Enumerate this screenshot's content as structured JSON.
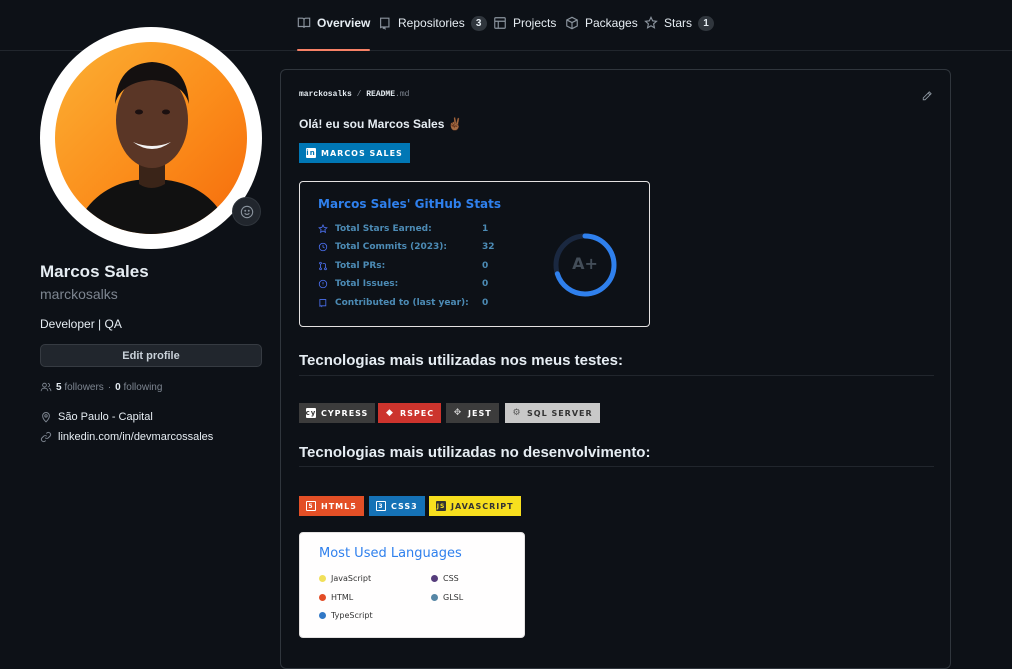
{
  "tabs": [
    {
      "label": "Overview",
      "icon": "book-icon",
      "active": true
    },
    {
      "label": "Repositories",
      "icon": "repo-icon",
      "count": "3"
    },
    {
      "label": "Projects",
      "icon": "table-icon"
    },
    {
      "label": "Packages",
      "icon": "package-icon"
    },
    {
      "label": "Stars",
      "icon": "star-icon",
      "count": "1"
    }
  ],
  "profile": {
    "name": "Marcos Sales",
    "login": "marckosalks",
    "bio": "Developer | QA",
    "edit_label": "Edit profile",
    "followers_count": "5",
    "followers_label": "followers",
    "separator": "·",
    "following_count": "0",
    "following_label": "following",
    "location": "São Paulo - Capital",
    "linkedin": "linkedin.com/in/devmarcossales"
  },
  "readme": {
    "path_user": "marckosalks",
    "path_sep": " / ",
    "path_file": "README",
    "path_ext": ".md",
    "greeting": "Olá! eu sou Marcos Sales ✌🏾",
    "linkedin_badge": {
      "label": "MARCOS SALES",
      "icon": "linkedin-icon",
      "color": "#0077b5"
    },
    "stats": {
      "title": "Marcos Sales' GitHub Stats",
      "rows": [
        {
          "label": "Total Stars Earned:",
          "value": "1",
          "icon": "star-icon"
        },
        {
          "label": "Total Commits (2023):",
          "value": "32",
          "icon": "history-icon"
        },
        {
          "label": "Total PRs:",
          "value": "0",
          "icon": "pull-request-icon"
        },
        {
          "label": "Total Issues:",
          "value": "0",
          "icon": "issue-icon"
        },
        {
          "label": "Contributed to (last year):",
          "value": "0",
          "icon": "repo-icon"
        }
      ],
      "grade": "A+",
      "grade_progress": 0.7,
      "ring_color": "#2f80ed"
    },
    "tests_heading": "Tecnologias mais utilizadas nos meus testes:",
    "tests_badges": [
      {
        "label": "CYPRESS",
        "bg": "#3c3c3c",
        "icon": "cypress-icon"
      },
      {
        "label": "RSPEC",
        "bg": "#cc342d",
        "icon": "ruby-icon"
      },
      {
        "label": "JEST",
        "bg": "#3c3c3c",
        "icon": "jest-icon"
      },
      {
        "label": "SQL SERVER",
        "bg": "#c8c8c8",
        "icon": "sql-server-icon"
      }
    ],
    "dev_heading": "Tecnologias mais utilizadas no desenvolvimento:",
    "dev_badges": [
      {
        "label": "HTML5",
        "bg": "#e34f26",
        "icon": "html5-icon"
      },
      {
        "label": "CSS3",
        "bg": "#1572b6",
        "icon": "css3-icon"
      },
      {
        "label": "JAVASCRIPT",
        "bg": "#f7df1e",
        "icon": "javascript-icon"
      }
    ],
    "languages": {
      "title": "Most Used Languages",
      "items": [
        {
          "label": "JavaScript",
          "color": "#f1e05a"
        },
        {
          "label": "CSS",
          "color": "#563d7c"
        },
        {
          "label": "HTML",
          "color": "#e34c26"
        },
        {
          "label": "GLSL",
          "color": "#5686a5"
        },
        {
          "label": "TypeScript",
          "color": "#3178c6"
        }
      ]
    }
  }
}
